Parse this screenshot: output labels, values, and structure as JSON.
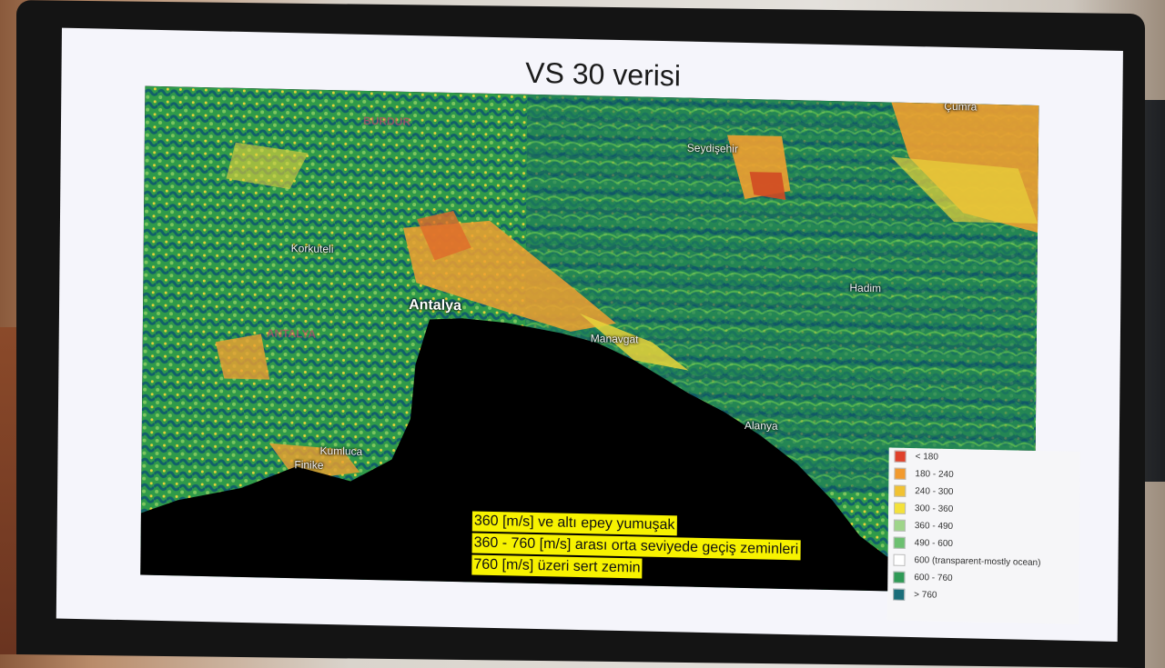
{
  "slide": {
    "title": "VS 30 verisi"
  },
  "map": {
    "places": [
      {
        "id": "burdur",
        "label": "BURDUR",
        "style": "faint"
      },
      {
        "id": "cumra",
        "label": "Çumra",
        "style": "normal"
      },
      {
        "id": "seydisehir",
        "label": "Seydişehir",
        "style": "normal"
      },
      {
        "id": "korkuteli",
        "label": "Korkuteli",
        "style": "normal"
      },
      {
        "id": "antalya",
        "label": "Antalya",
        "style": "big"
      },
      {
        "id": "antalya-region",
        "label": "ANTALYA",
        "style": "faint"
      },
      {
        "id": "hadim",
        "label": "Hadim",
        "style": "normal"
      },
      {
        "id": "manavgat",
        "label": "Manavgat",
        "style": "normal"
      },
      {
        "id": "alanya",
        "label": "Alanya",
        "style": "normal"
      },
      {
        "id": "kumluca",
        "label": "Kumluca",
        "style": "normal"
      },
      {
        "id": "finike",
        "label": "Finike",
        "style": "normal"
      }
    ],
    "colors": {
      "ocean": "#000000",
      "hard": "#12606a",
      "mid_dark": "#2f9a4a",
      "mid": "#5fbb52",
      "mid_light": "#8fd070",
      "soft_yellow": "#e8d23a",
      "soft_orange": "#f0a030",
      "very_soft": "#e04020"
    }
  },
  "legend": {
    "items": [
      {
        "label": "< 180",
        "color": "#e0402a"
      },
      {
        "label": "180 - 240",
        "color": "#f29a2e"
      },
      {
        "label": "240 - 300",
        "color": "#f1c232"
      },
      {
        "label": "300 - 360",
        "color": "#f4e23a"
      },
      {
        "label": "360 - 490",
        "color": "#9fd58a"
      },
      {
        "label": "490 - 600",
        "color": "#6cc070"
      },
      {
        "label": "600 (transparent-mostly ocean)",
        "color": "#ffffff"
      },
      {
        "label": "600 - 760",
        "color": "#2e9a55"
      },
      {
        "label": "> 760",
        "color": "#1a6e7a"
      }
    ]
  },
  "notes": {
    "line1": "360 [m/s] ve altı epey yumuşak",
    "line2": "360 - 760 [m/s] arası orta seviyede geçiş zeminleri",
    "line3": "760 [m/s] üzeri sert zemin"
  }
}
